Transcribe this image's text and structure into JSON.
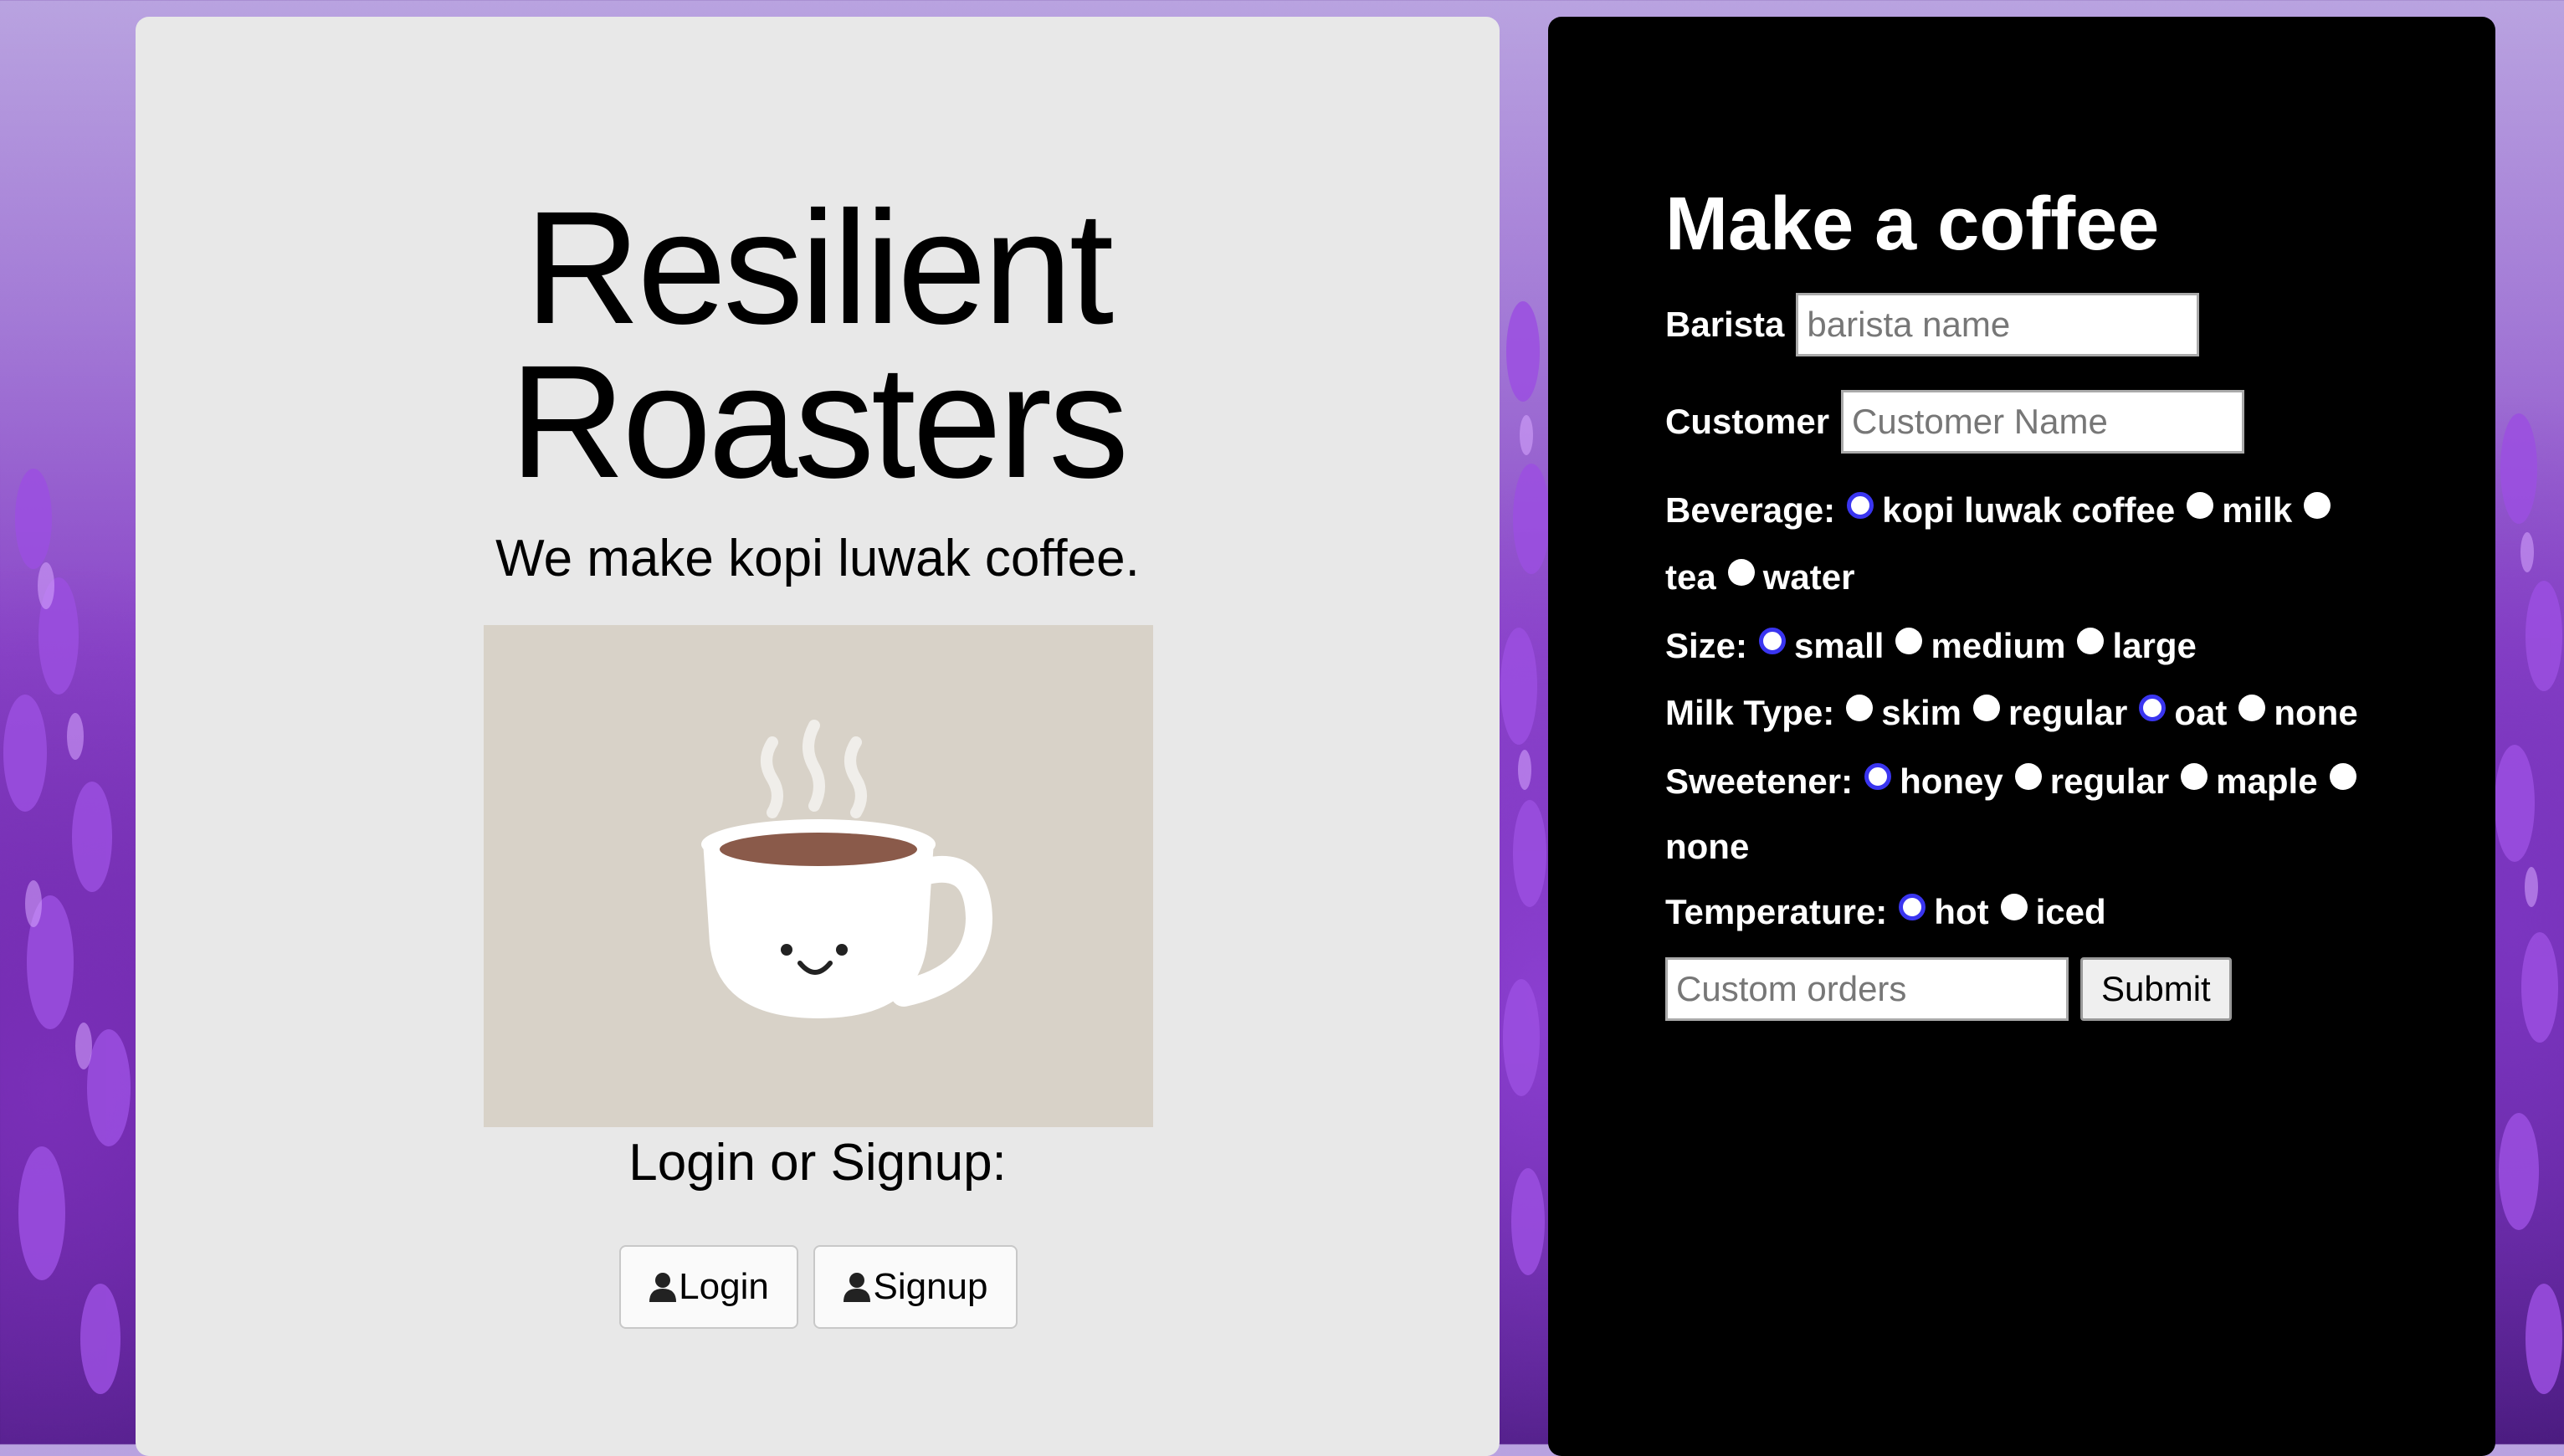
{
  "brand": {
    "title_line1": "Resilient",
    "title_line2": "Roasters",
    "tagline": "We make kopi luwak coffee.",
    "login_prompt": "Login or Signup:",
    "login_button": "Login",
    "signup_button": "Signup"
  },
  "order_form": {
    "title": "Make a coffee",
    "barista_label": "Barista",
    "barista_placeholder": "barista name",
    "customer_label": "Customer",
    "customer_placeholder": "Customer Name",
    "beverage": {
      "label": "Beverage:",
      "options": [
        "kopi luwak coffee",
        "milk",
        "tea",
        "water"
      ],
      "selected": "kopi luwak coffee"
    },
    "size": {
      "label": "Size:",
      "options": [
        "small",
        "medium",
        "large"
      ],
      "selected": "small"
    },
    "milk_type": {
      "label": "Milk Type:",
      "options": [
        "skim",
        "regular",
        "oat",
        "none"
      ],
      "selected": "oat"
    },
    "sweetener": {
      "label": "Sweetener:",
      "options": [
        "honey",
        "regular",
        "maple",
        "none"
      ],
      "selected": "honey"
    },
    "temperature": {
      "label": "Temperature:",
      "options": [
        "hot",
        "iced"
      ],
      "selected": "hot"
    },
    "custom_placeholder": "Custom orders",
    "submit_label": "Submit"
  },
  "colors": {
    "radio_selected": "#3a35f0",
    "left_panel": "#e8e8e8",
    "right_panel": "#000000",
    "hero_background": "#d8d2c8"
  }
}
